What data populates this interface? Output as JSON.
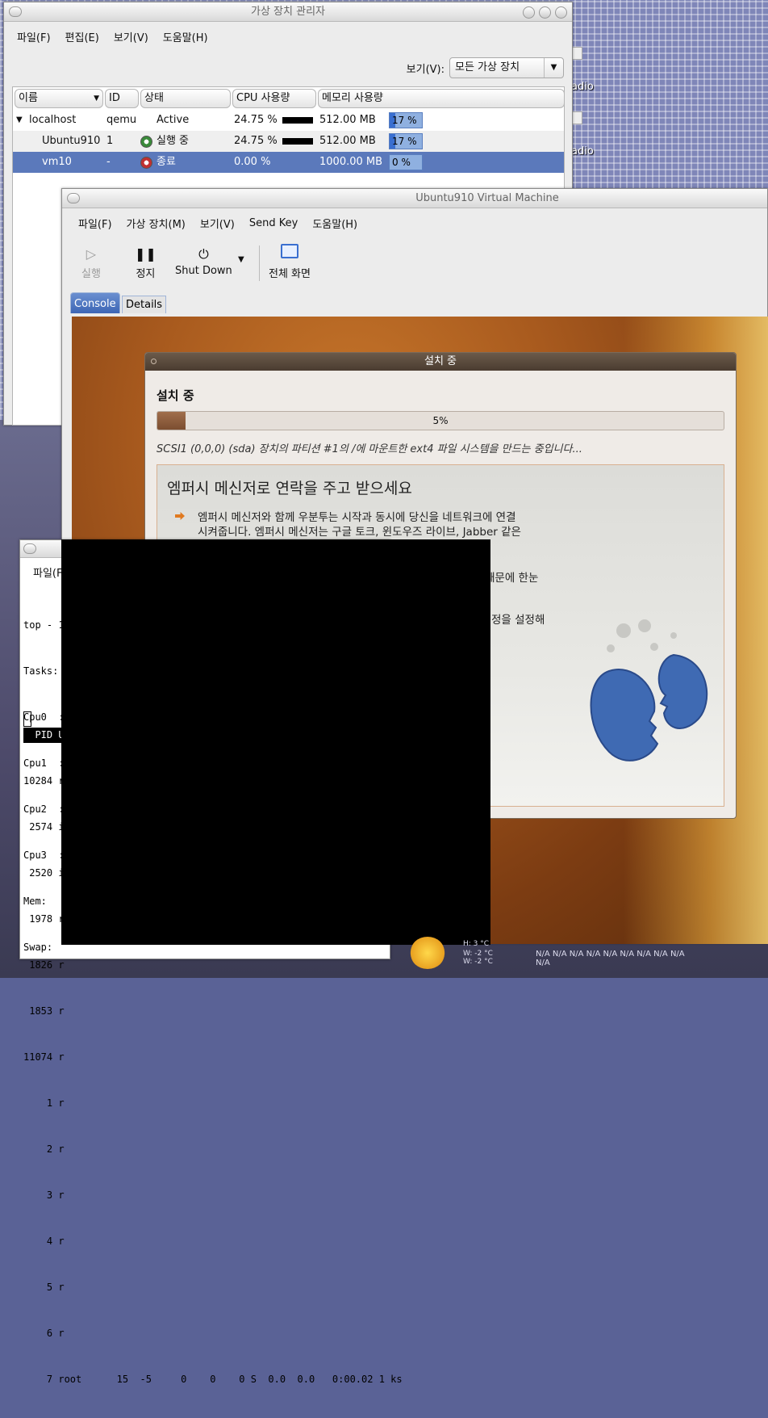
{
  "desktop": {
    "icon_labels": [
      "adio",
      "adio"
    ],
    "weather": {
      "line1": "H: 3 °C",
      "line2": "W: -2 °C",
      "line3": "W: -2 °C",
      "forecast": "N/A N/A N/A N/A N/A N/A N/A N/A N/A N/A"
    }
  },
  "vmm": {
    "title": "가상 장치 관리자",
    "menu": [
      "파일(F)",
      "편집(E)",
      "보기(V)",
      "도움말(H)"
    ],
    "filter_label": "보기(V):",
    "filter_value": "모든 가상 장치",
    "columns": [
      "이름",
      "ID",
      "상태",
      "CPU 사용량",
      "메모리 사용량"
    ],
    "rows": [
      {
        "name": "localhost",
        "id": "qemu",
        "state": "Active",
        "cpu": "24.75 %",
        "mem": "512.00 MB",
        "mem_pct": "17 %",
        "mem_fraction": 0.17
      },
      {
        "name": "Ubuntu910",
        "id": "1",
        "state": "실행 중",
        "cpu": "24.75 %",
        "mem": "512.00 MB",
        "mem_pct": "17 %",
        "mem_fraction": 0.17
      },
      {
        "name": "vm10",
        "id": "-",
        "state": "종료",
        "cpu": "0.00 %",
        "mem": "1000.00 MB",
        "mem_pct": "0 %",
        "mem_fraction": 0.0
      }
    ]
  },
  "vmwin": {
    "title": "Ubuntu910 Virtual Machine",
    "menu": [
      "파일(F)",
      "가상 장치(M)",
      "보기(V)",
      "Send Key",
      "도움말(H)"
    ],
    "toolbar": {
      "run": "실행",
      "pause": "정지",
      "shutdown": "Shut Down",
      "fullscreen": "전체 화면"
    },
    "tabs": [
      "Console",
      "Details"
    ]
  },
  "installer": {
    "title": "설치 중",
    "heading": "설치 중",
    "progress_pct": 0.05,
    "progress_label": "5%",
    "status": "SCSI1 (0,0,0) (sda) 장치의 파티션 #1의 /에 마운트한 ext4 파일 시스템을 만드는 중입니다...",
    "slide_title": "엠퍼시 메신저로 연락을 주고 받으세요",
    "slide_para_1": "엠퍼시 메신저와 함께 우분투는 시작과 동시에 당신을 네트워크에 연결",
    "slide_para_2": "시켜줍니다. 엠퍼시 메신저는 구글 토크, 윈도우즈 라이브, Jabber 같은",
    "slide_frag_1": "때문에 한눈",
    "slide_frag_2": "정을 설정해"
  },
  "terminal": {
    "menu_fragment": "파일(F",
    "lines": [
      "top - 1",
      "Tasks:",
      "Cpu0  :",
      "Cpu1  :",
      "Cpu2  :",
      "Cpu3  :",
      "Mem:",
      "Swap:"
    ],
    "header": "  PID U",
    "procs": [
      "10284 r",
      " 2574 i",
      " 2520 i",
      " 1978 r",
      " 1826 r",
      " 1853 r",
      "11074 r",
      "    1 r",
      "    2 r",
      "    3 r",
      "    4 r",
      "    5 r",
      "    6 r"
    ],
    "last_line": "    7 root      15  -5     0    0    0 S  0.0  0.0   0:00.02 1 ks"
  }
}
